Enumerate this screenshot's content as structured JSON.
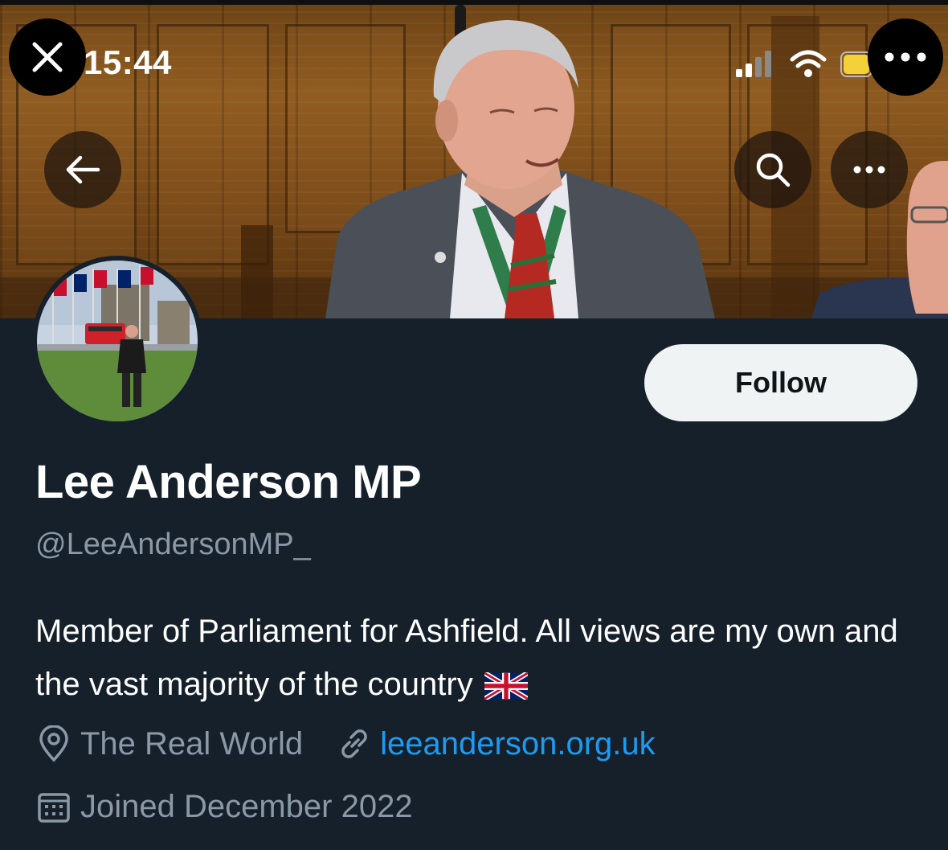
{
  "status_bar": {
    "time": "15:44"
  },
  "profile": {
    "display_name": "Lee Anderson MP",
    "handle": "@LeeAndersonMP_",
    "bio": "Member of Parliament for Ashfield. All views are my own and the vast majority of the country",
    "bio_emoji": "uk-flag",
    "location": "The Real World",
    "website": "leeanderson.org.uk",
    "joined": "Joined December 2022"
  },
  "actions": {
    "follow_label": "Follow"
  },
  "icons": {
    "close": "close-icon",
    "more_top": "more-dots-icon",
    "back": "back-arrow-icon",
    "search": "search-icon",
    "more": "more-dots-icon",
    "location": "location-pin-icon",
    "link": "link-icon",
    "calendar": "calendar-icon"
  },
  "colors": {
    "background": "#15202b",
    "accent_link": "#1d9bf0",
    "secondary_text": "#8b98a5",
    "follow_bg": "#eff3f4",
    "battery": "#f2d13a"
  }
}
